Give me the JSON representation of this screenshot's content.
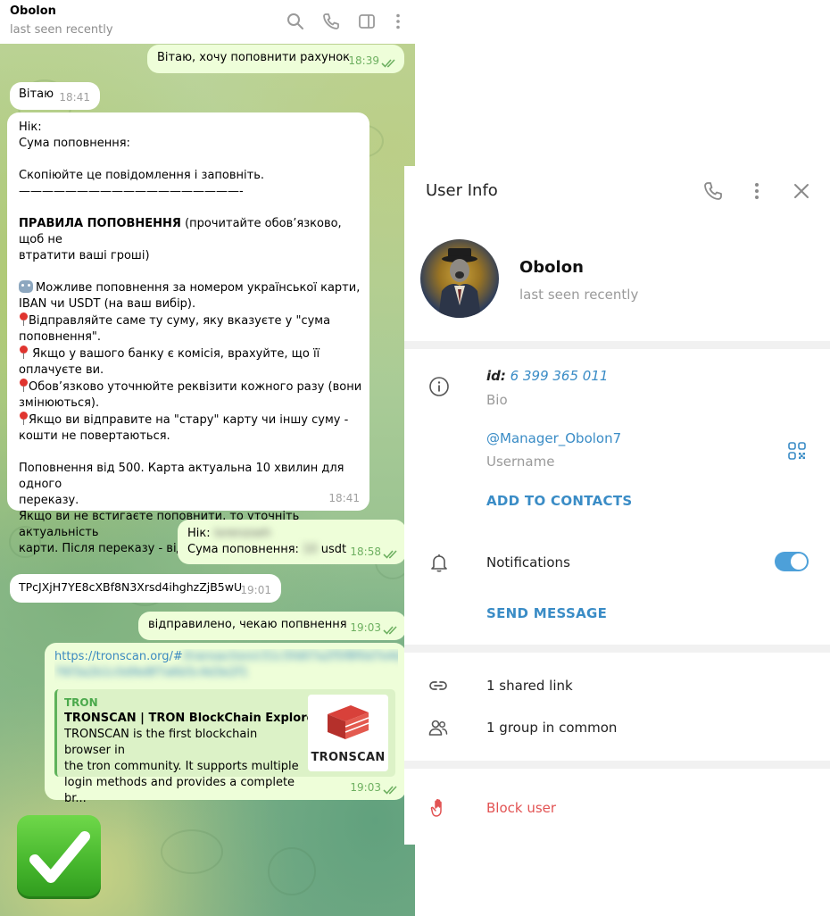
{
  "chat": {
    "header": {
      "title": "Obolon",
      "status": "last seen recently"
    },
    "messages": [
      {
        "dir": "out",
        "text": "Вітаю, хочу поповнити рахунок",
        "time": "18:39"
      },
      {
        "dir": "in",
        "text": "Вітаю",
        "time": "18:41"
      },
      {
        "dir": "in",
        "time": "18:41",
        "lines": {
          "l1": "Нік:",
          "l2": "Сума поповнення:",
          "l3": "Скопіюйте це повідомлення і заповніть.",
          "l4": "———————————————————-",
          "l5_bold": "ПРАВИЛА ПОПОВНЕННЯ",
          "l5_rest": " (прочитайте обов’язково, щоб не",
          "l6": "втратити ваші гроші)",
          "l7": "Можливе поповнення за номером української карти,",
          "l8": "IBAN чи USDT (на ваш вибір).",
          "l9": "Відправляйте саме ту суму, яку вказуєте у \"сума",
          "l10": "поповнення\".",
          "l11": " Якщо у вашого банку є комісія, врахуйте, що її",
          "l12": "оплачуєте ви.",
          "l13": "Обов’язково уточнюйте реквізити кожного разу (вони",
          "l14": "змінюються).",
          "l15": "Якщо ви відправите на \"стару\" карту чи іншу суму -",
          "l16": "кошти не повертаються.",
          "l17": "Поповнення від 500. Карта актуальна 10 хвилин для одного",
          "l18": "переказу.",
          "l19": "Якщо ви не встигаєте поповнити, то уточніть актуальність",
          "l20": "карти. Після переказу - відправте квитанцію."
        }
      },
      {
        "dir": "out",
        "time": "18:58",
        "nick_label": "Нік:",
        "nick_value": "lorenzoeh",
        "sum_label": "Сума поповнення:",
        "sum_value": "10",
        "sum_unit": "usdt"
      },
      {
        "dir": "in",
        "text": "TPcJXjH7YE8cXBf8N3Xrsd4ihghzZjB5wU",
        "time": "19:01"
      },
      {
        "dir": "out",
        "text": "відправилено, чекаю попвнення",
        "time": "19:03"
      },
      {
        "dir": "out",
        "time": "19:03",
        "link_visible": "https://tronscan.org/#",
        "link_blurred": "/transaction/c51c5fd07a2f5f8f0d7e4d3c1b2a9988",
        "link_blurred2": "76f3a2b1c0d9e8f7a6b5c4d3e2f1",
        "preview": {
          "site": "TRON",
          "title": "TRONSCAN | TRON BlockChain Explorer",
          "desc_l1": "TRONSCAN is the first blockchain browser in",
          "desc_l2": "the tron community. It supports multiple",
          "desc_l3": "login methods and provides a complete br...",
          "thumb_label": "TRONSCAN"
        }
      }
    ],
    "emoji": "check-mark-button"
  },
  "panel": {
    "title": "User Info",
    "name": "Obolon",
    "status": "last seen recently",
    "id_label": "id:",
    "id_value": "6 399 365 011",
    "bio_label": "Bio",
    "username": "@Manager_Obolon7",
    "username_label": "Username",
    "add_contacts": "ADD TO CONTACTS",
    "notifications": "Notifications",
    "notifications_on": true,
    "send_message": "SEND MESSAGE",
    "shared_links": "1 shared link",
    "groups_common": "1 group in common",
    "block_user": "Block user"
  },
  "colors": {
    "accent": "#3a8cc6",
    "danger": "#e25353",
    "outgoing": "#eefed9",
    "check_green": "#6eb061"
  }
}
